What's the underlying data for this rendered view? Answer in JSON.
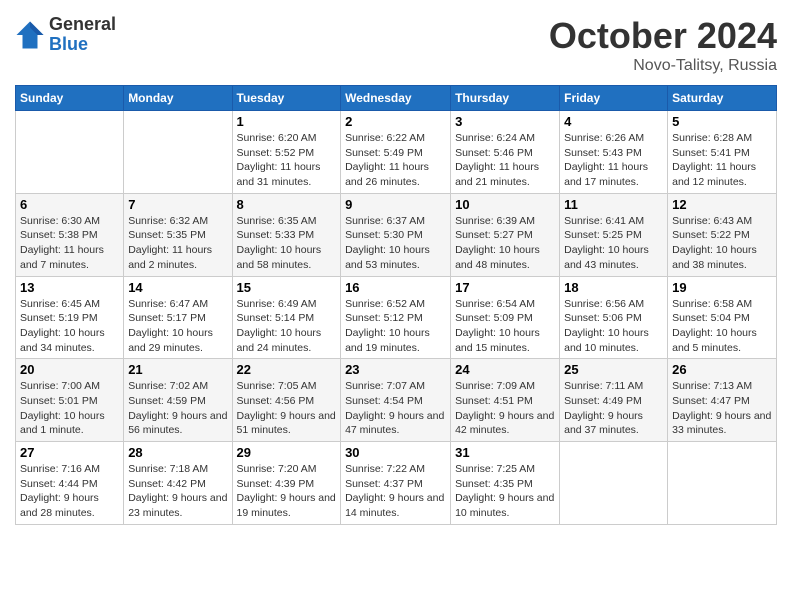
{
  "logo": {
    "general": "General",
    "blue": "Blue"
  },
  "title": "October 2024",
  "location": "Novo-Talitsy, Russia",
  "days_header": [
    "Sunday",
    "Monday",
    "Tuesday",
    "Wednesday",
    "Thursday",
    "Friday",
    "Saturday"
  ],
  "weeks": [
    [
      {
        "day": "",
        "info": ""
      },
      {
        "day": "",
        "info": ""
      },
      {
        "day": "1",
        "info": "Sunrise: 6:20 AM\nSunset: 5:52 PM\nDaylight: 11 hours and 31 minutes."
      },
      {
        "day": "2",
        "info": "Sunrise: 6:22 AM\nSunset: 5:49 PM\nDaylight: 11 hours and 26 minutes."
      },
      {
        "day": "3",
        "info": "Sunrise: 6:24 AM\nSunset: 5:46 PM\nDaylight: 11 hours and 21 minutes."
      },
      {
        "day": "4",
        "info": "Sunrise: 6:26 AM\nSunset: 5:43 PM\nDaylight: 11 hours and 17 minutes."
      },
      {
        "day": "5",
        "info": "Sunrise: 6:28 AM\nSunset: 5:41 PM\nDaylight: 11 hours and 12 minutes."
      }
    ],
    [
      {
        "day": "6",
        "info": "Sunrise: 6:30 AM\nSunset: 5:38 PM\nDaylight: 11 hours and 7 minutes."
      },
      {
        "day": "7",
        "info": "Sunrise: 6:32 AM\nSunset: 5:35 PM\nDaylight: 11 hours and 2 minutes."
      },
      {
        "day": "8",
        "info": "Sunrise: 6:35 AM\nSunset: 5:33 PM\nDaylight: 10 hours and 58 minutes."
      },
      {
        "day": "9",
        "info": "Sunrise: 6:37 AM\nSunset: 5:30 PM\nDaylight: 10 hours and 53 minutes."
      },
      {
        "day": "10",
        "info": "Sunrise: 6:39 AM\nSunset: 5:27 PM\nDaylight: 10 hours and 48 minutes."
      },
      {
        "day": "11",
        "info": "Sunrise: 6:41 AM\nSunset: 5:25 PM\nDaylight: 10 hours and 43 minutes."
      },
      {
        "day": "12",
        "info": "Sunrise: 6:43 AM\nSunset: 5:22 PM\nDaylight: 10 hours and 38 minutes."
      }
    ],
    [
      {
        "day": "13",
        "info": "Sunrise: 6:45 AM\nSunset: 5:19 PM\nDaylight: 10 hours and 34 minutes."
      },
      {
        "day": "14",
        "info": "Sunrise: 6:47 AM\nSunset: 5:17 PM\nDaylight: 10 hours and 29 minutes."
      },
      {
        "day": "15",
        "info": "Sunrise: 6:49 AM\nSunset: 5:14 PM\nDaylight: 10 hours and 24 minutes."
      },
      {
        "day": "16",
        "info": "Sunrise: 6:52 AM\nSunset: 5:12 PM\nDaylight: 10 hours and 19 minutes."
      },
      {
        "day": "17",
        "info": "Sunrise: 6:54 AM\nSunset: 5:09 PM\nDaylight: 10 hours and 15 minutes."
      },
      {
        "day": "18",
        "info": "Sunrise: 6:56 AM\nSunset: 5:06 PM\nDaylight: 10 hours and 10 minutes."
      },
      {
        "day": "19",
        "info": "Sunrise: 6:58 AM\nSunset: 5:04 PM\nDaylight: 10 hours and 5 minutes."
      }
    ],
    [
      {
        "day": "20",
        "info": "Sunrise: 7:00 AM\nSunset: 5:01 PM\nDaylight: 10 hours and 1 minute."
      },
      {
        "day": "21",
        "info": "Sunrise: 7:02 AM\nSunset: 4:59 PM\nDaylight: 9 hours and 56 minutes."
      },
      {
        "day": "22",
        "info": "Sunrise: 7:05 AM\nSunset: 4:56 PM\nDaylight: 9 hours and 51 minutes."
      },
      {
        "day": "23",
        "info": "Sunrise: 7:07 AM\nSunset: 4:54 PM\nDaylight: 9 hours and 47 minutes."
      },
      {
        "day": "24",
        "info": "Sunrise: 7:09 AM\nSunset: 4:51 PM\nDaylight: 9 hours and 42 minutes."
      },
      {
        "day": "25",
        "info": "Sunrise: 7:11 AM\nSunset: 4:49 PM\nDaylight: 9 hours and 37 minutes."
      },
      {
        "day": "26",
        "info": "Sunrise: 7:13 AM\nSunset: 4:47 PM\nDaylight: 9 hours and 33 minutes."
      }
    ],
    [
      {
        "day": "27",
        "info": "Sunrise: 7:16 AM\nSunset: 4:44 PM\nDaylight: 9 hours and 28 minutes."
      },
      {
        "day": "28",
        "info": "Sunrise: 7:18 AM\nSunset: 4:42 PM\nDaylight: 9 hours and 23 minutes."
      },
      {
        "day": "29",
        "info": "Sunrise: 7:20 AM\nSunset: 4:39 PM\nDaylight: 9 hours and 19 minutes."
      },
      {
        "day": "30",
        "info": "Sunrise: 7:22 AM\nSunset: 4:37 PM\nDaylight: 9 hours and 14 minutes."
      },
      {
        "day": "31",
        "info": "Sunrise: 7:25 AM\nSunset: 4:35 PM\nDaylight: 9 hours and 10 minutes."
      },
      {
        "day": "",
        "info": ""
      },
      {
        "day": "",
        "info": ""
      }
    ]
  ]
}
